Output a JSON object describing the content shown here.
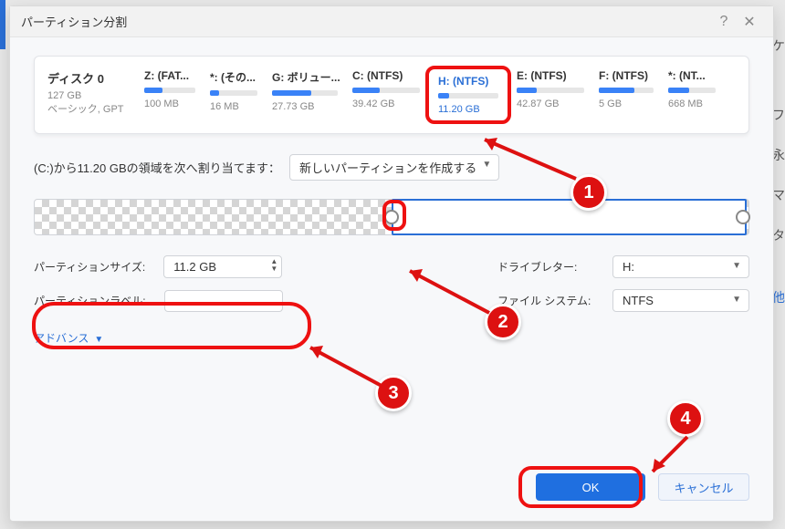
{
  "dialog": {
    "title": "パーティション分割",
    "help_icon": "?",
    "close_icon": "✕"
  },
  "disk": {
    "name": "ディスク 0",
    "size": "127 GB",
    "type": "ベーシック, GPT"
  },
  "partitions": [
    {
      "label": "Z: (FAT...",
      "size": "100 MB",
      "fill": "35%"
    },
    {
      "label": "*: (その...",
      "size": "16 MB",
      "fill": "20%"
    },
    {
      "label": "G: ボリュー...",
      "size": "27.73 GB",
      "fill": "60%"
    },
    {
      "label": "C: (NTFS)",
      "size": "39.42 GB",
      "fill": "40%"
    },
    {
      "label": "H: (NTFS)",
      "size": "11.20 GB",
      "fill": "18%",
      "selected": true
    },
    {
      "label": "E: (NTFS)",
      "size": "42.87 GB",
      "fill": "30%"
    },
    {
      "label": "F: (NTFS)",
      "size": "5 GB",
      "fill": "65%"
    },
    {
      "label": "*: (NT...",
      "size": "668 MB",
      "fill": "45%"
    }
  ],
  "allocate": {
    "text": "(C:)から11.20 GBの領域を次へ割り当てます：",
    "option": "新しいパーティションを作成する"
  },
  "fields": {
    "partition_size_label": "パーティションサイズ:",
    "partition_size_value": "11.2 GB",
    "partition_label_label": "パーティションラベル:",
    "partition_label_value": "",
    "drive_letter_label": "ドライブレター:",
    "drive_letter_value": "H:",
    "file_system_label": "ファイル システム:",
    "file_system_value": "NTFS",
    "advance": "アドバンス"
  },
  "buttons": {
    "ok": "OK",
    "cancel": "キャンセル"
  },
  "annotations": {
    "b1": "1",
    "b2": "2",
    "b3": "3",
    "b4": "4"
  },
  "peek": [
    "ケ",
    "フ",
    "永",
    "マ",
    "タ",
    "他"
  ]
}
